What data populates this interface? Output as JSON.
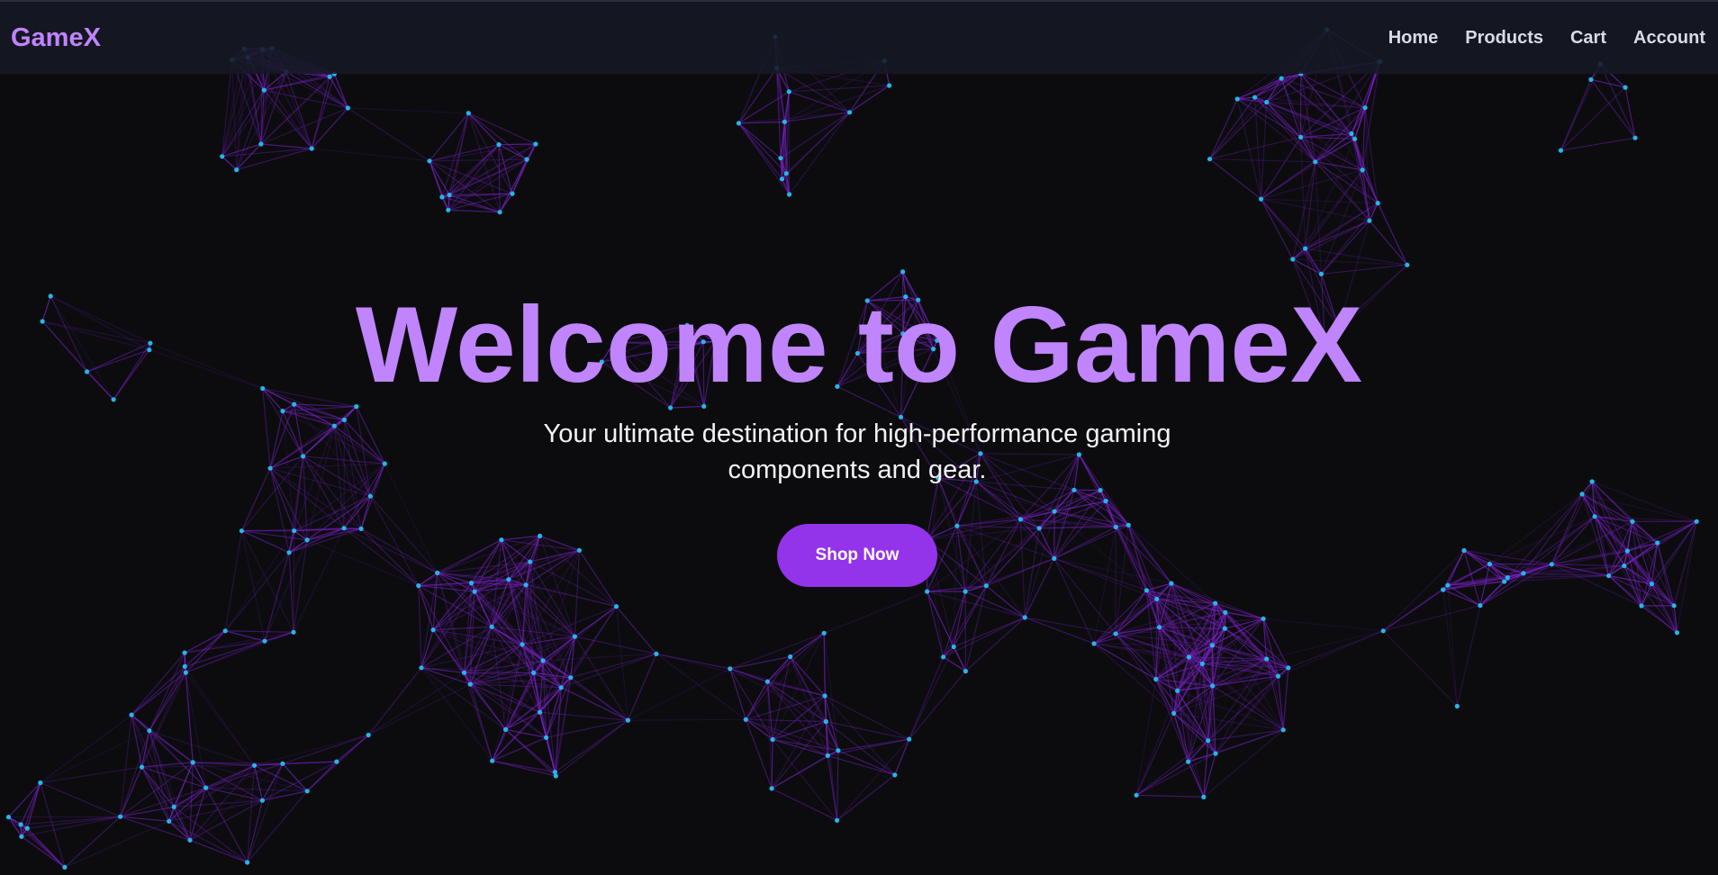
{
  "nav": {
    "brand": "GameX",
    "links": [
      {
        "label": "Home"
      },
      {
        "label": "Products"
      },
      {
        "label": "Cart"
      },
      {
        "label": "Account"
      }
    ]
  },
  "hero": {
    "title": "Welcome to GameX",
    "subtitle": "Your ultimate destination for high-performance gaming components and gear.",
    "cta_label": "Shop Now"
  },
  "colors": {
    "background": "#0c0c0f",
    "accent": "#c084fc",
    "button": "#9333ea",
    "network_line": "#7e22ce",
    "network_node": "#22b8e6"
  }
}
